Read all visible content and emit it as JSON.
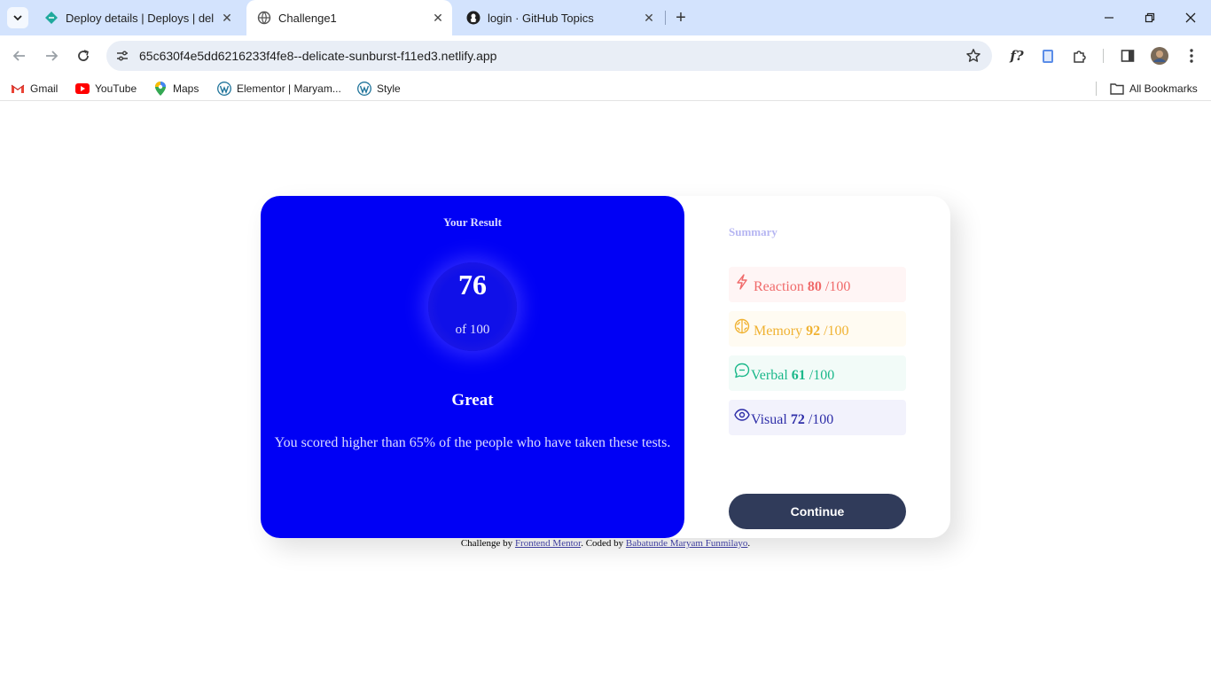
{
  "browser": {
    "tabs": [
      {
        "title": "Deploy details | Deploys | delica",
        "active": false,
        "icon": "netlify-icon"
      },
      {
        "title": "Challenge1",
        "active": true,
        "icon": "globe-icon"
      },
      {
        "title": "login · GitHub Topics",
        "active": false,
        "icon": "github-icon"
      }
    ],
    "url": "65c630f4e5dd6216233f4fe8--delicate-sunburst-f11ed3.netlify.app",
    "bookmarks": [
      {
        "label": "Gmail",
        "icon": "gmail-icon"
      },
      {
        "label": "YouTube",
        "icon": "youtube-icon"
      },
      {
        "label": "Maps",
        "icon": "maps-icon"
      },
      {
        "label": "Elementor | Maryam...",
        "icon": "wordpress-icon"
      },
      {
        "label": "Style",
        "icon": "wordpress-icon"
      }
    ],
    "all_bookmarks_label": "All Bookmarks",
    "extension_label": "f?"
  },
  "result": {
    "heading": "Your Result",
    "score": "76",
    "of_label": "of 100",
    "grade": "Great",
    "description": "You scored higher than 65% of the people who have taken these tests."
  },
  "summary": {
    "title": "Summary",
    "items": [
      {
        "name": "Reaction",
        "score": "80",
        "max": "/100",
        "color": "#f06a6a",
        "bg": "#fff5f5",
        "icon": "lightning-icon"
      },
      {
        "name": "Memory",
        "score": "92",
        "max": "/100",
        "color": "#f0b232",
        "bg": "#fffbf2",
        "icon": "brain-icon"
      },
      {
        "name": "Verbal",
        "score": "61",
        "max": "/100",
        "color": "#1bb88a",
        "bg": "#f2fbf8",
        "icon": "chat-icon"
      },
      {
        "name": "Visual",
        "score": "72",
        "max": "/100",
        "color": "#2e2ea8",
        "bg": "#f2f2fc",
        "icon": "eye-icon"
      }
    ],
    "button_label": "Continue"
  },
  "attribution": {
    "prefix": "Challenge by",
    "link1": "Frontend Mentor",
    "middle": ". Coded by",
    "link2": "Babatunde Maryam Funmilayo",
    "suffix": "."
  },
  "colors": {
    "result_bg": "#0000f5",
    "button_bg": "#303b5a",
    "tabbar_bg": "#d3e3fd"
  }
}
